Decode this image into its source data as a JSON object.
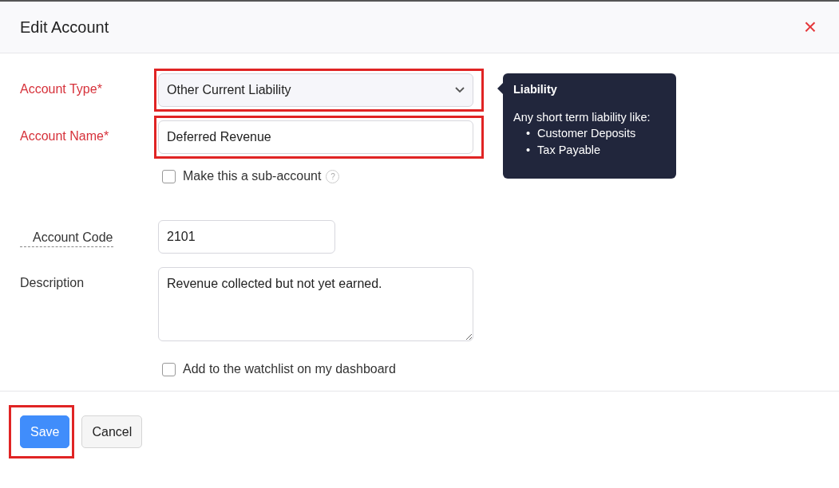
{
  "dialog": {
    "title": "Edit Account",
    "close": "×"
  },
  "fields": [
    {
      "kind": "select",
      "label": "Account Type*",
      "required": true,
      "underlined": false,
      "value": "Other Current Liability",
      "highlighted": true
    },
    {
      "kind": "text",
      "label": "Account Name*",
      "required": true,
      "underlined": false,
      "value": "Deferred Revenue",
      "highlighted": true
    },
    {
      "kind": "checkbox",
      "label": "Make this a sub-account",
      "checked": false,
      "help": "?"
    },
    {
      "kind": "code",
      "label": "Account Code",
      "required": false,
      "underlined": true,
      "value": "2101",
      "highlighted": false
    },
    {
      "kind": "textarea",
      "label": "Description",
      "required": false,
      "underlined": false,
      "value": "Revenue collected but not yet earned.",
      "highlighted": false
    },
    {
      "kind": "checkbox",
      "label": "Add to the watchlist on my dashboard",
      "checked": false
    }
  ],
  "tooltip": {
    "title": "Liability",
    "text": "Any short term liability like:",
    "items": [
      {
        "bullet": "•",
        "text": "Customer Deposits"
      },
      {
        "bullet": "•",
        "text": "Tax Payable"
      }
    ]
  },
  "buttons": [
    {
      "kind": "primary",
      "label": "Save",
      "highlighted": true
    },
    {
      "kind": "secondary",
      "label": "Cancel",
      "highlighted": false
    }
  ]
}
